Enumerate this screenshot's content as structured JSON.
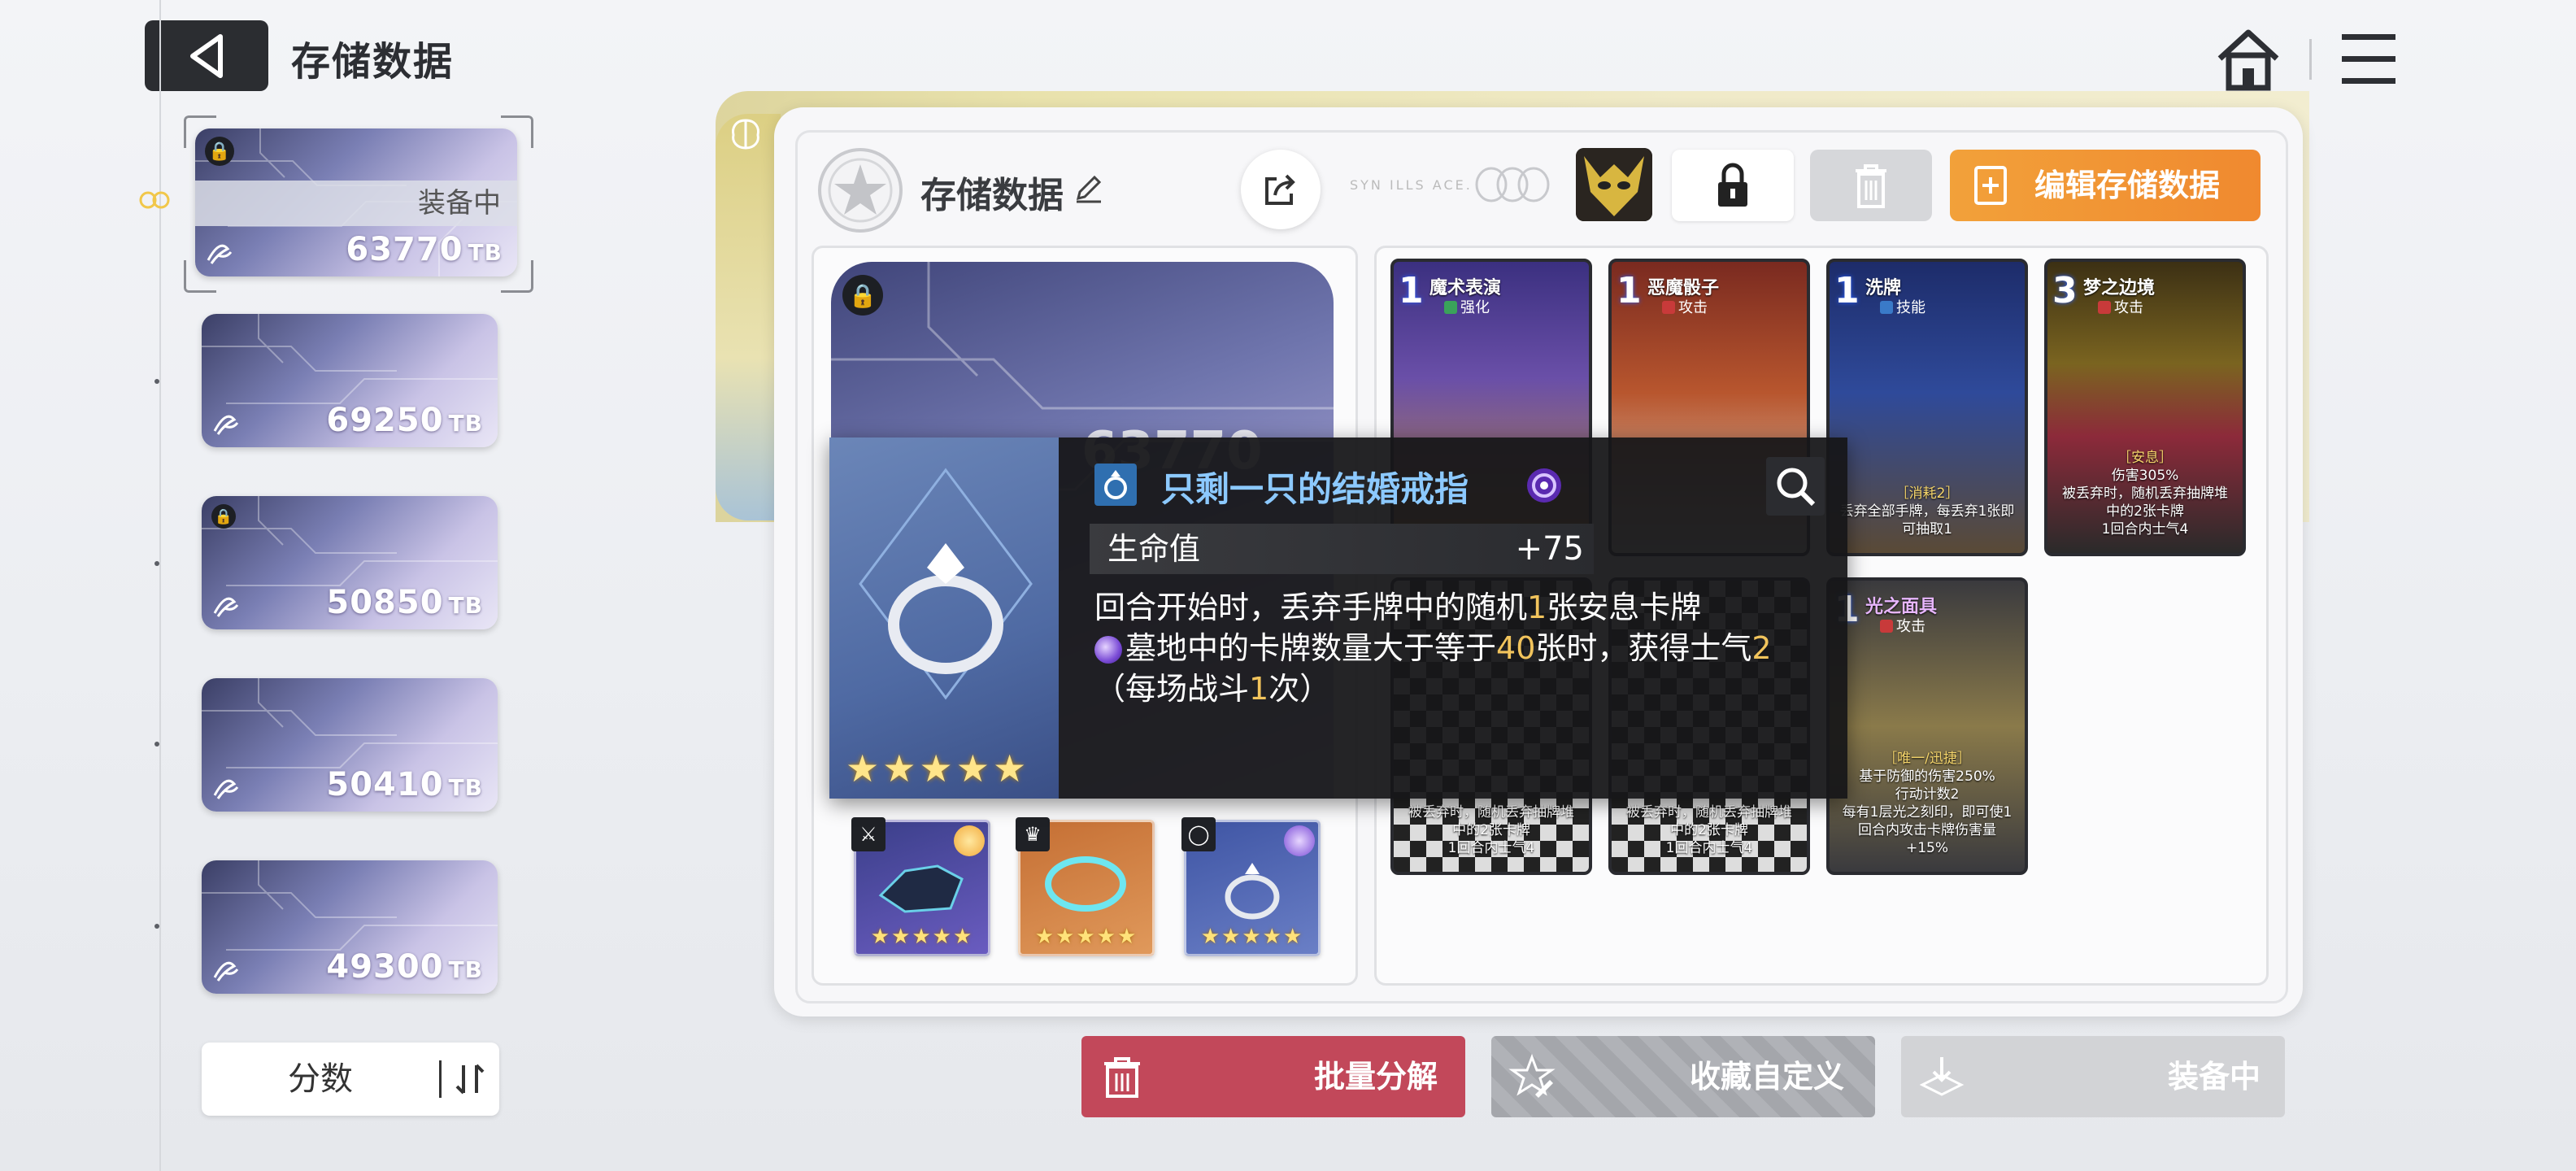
{
  "header": {
    "title": "存储数据",
    "back_icon": "back-arrow-icon",
    "home_icon": "home-icon",
    "menu_icon": "menu-icon"
  },
  "slots": [
    {
      "score": "63770",
      "unit": "TB",
      "locked": true,
      "status": "装备中",
      "selected": true
    },
    {
      "score": "69250",
      "unit": "TB",
      "locked": false
    },
    {
      "score": "50850",
      "unit": "TB",
      "locked": true
    },
    {
      "score": "50410",
      "unit": "TB",
      "locked": false
    },
    {
      "score": "49300",
      "unit": "TB",
      "locked": false
    }
  ],
  "sort": {
    "label": "分数",
    "icon": "sort-order-icon"
  },
  "panel": {
    "title": "存储数据",
    "edit_button": "编辑存储数据",
    "deco_text": "SYN ILLS ACE.",
    "hero_score": "63770"
  },
  "relics": [
    {
      "type_icon": "sword-icon",
      "badge": "sun-badge",
      "stars": "★★★★★",
      "color": "#5a4aa8"
    },
    {
      "type_icon": "armor-icon",
      "badge": "",
      "stars": "★★★★★",
      "color": "#c9773b"
    },
    {
      "type_icon": "ring-icon",
      "badge": "orb-badge",
      "stars": "★★★★★",
      "color": "#4b5da8"
    }
  ],
  "cards": [
    {
      "cost": "1",
      "name": "魔术表演",
      "kind": "强化",
      "kind_color": "#3aa35a",
      "desc": ""
    },
    {
      "cost": "1",
      "name": "恶魔骰子",
      "kind": "攻击",
      "kind_color": "#c83a3a",
      "desc": ""
    },
    {
      "cost": "1",
      "name": "洗牌",
      "kind": "技能",
      "kind_color": "#3a7ac8",
      "desc_head": "［消耗2］",
      "desc": "丢弃全部手牌，每丢弃1张即可抽取1"
    },
    {
      "cost": "3",
      "name": "梦之边境",
      "kind": "攻击",
      "kind_color": "#c83a3a",
      "desc_head": "［安息］",
      "desc": "伤害305%\n被丢弃时，随机丢弃抽牌堆中的2张卡牌\n1回合内士气4"
    },
    {
      "cost": "",
      "name": "",
      "kind": "",
      "kind_color": "#c83a3a",
      "desc": "被丢弃时，随机丢弃抽牌堆中的2张卡牌\n1回合内士气4"
    },
    {
      "cost": "",
      "name": "",
      "kind": "",
      "kind_color": "#c83a3a",
      "desc": "被丢弃时，随机丢弃抽牌堆中的2张卡牌\n1回合内士气4"
    },
    {
      "cost": "1",
      "name": "光之面具",
      "kind": "攻击",
      "kind_color": "#c83a3a",
      "desc_head": "［唯一/迅捷］",
      "desc": "基于防御的伤害250%\n行动计数2\n每有1层光之刻印，即可使1回合内攻击卡牌伤害量+15%"
    }
  ],
  "tooltip": {
    "name": "只剩一只的结婚戒指",
    "stat_label": "生命值",
    "stat_value": "+75",
    "stars": "★★★★★",
    "line1_a": "回合开始时，丢弃手牌中的随机",
    "line1_n": "1",
    "line1_b": "张安息卡牌",
    "line2_a": "墓地中的卡牌数量大于等于",
    "line2_n": "40",
    "line2_b": "张时，获得士气",
    "line2_n2": "2",
    "line2_c": "（每场战斗",
    "line2_n3": "1",
    "line2_d": "次）"
  },
  "buttons": {
    "bulk": "批量分解",
    "favorite": "收藏自定义",
    "equip": "装备中"
  }
}
